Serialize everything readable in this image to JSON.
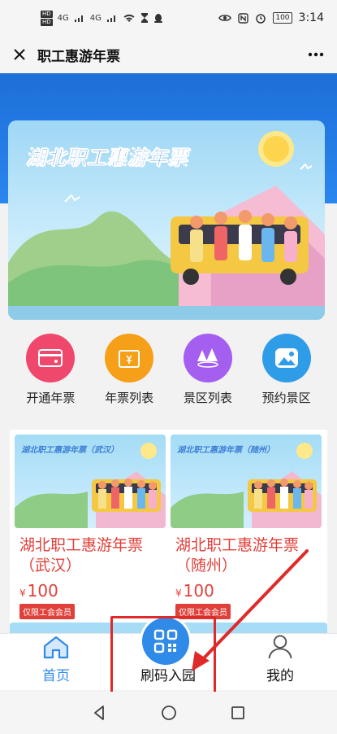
{
  "status_bar": {
    "sim1": "HD",
    "sim2": "HD",
    "network1": "4G",
    "network2": "4G",
    "battery": "100",
    "time": "3:14"
  },
  "title_bar": {
    "title": "职工惠游年票"
  },
  "banner": {
    "title": "湖北职工惠游年票"
  },
  "menu": [
    {
      "label": "开通年票",
      "icon": "card-icon",
      "color": "#f0476c"
    },
    {
      "label": "年票列表",
      "icon": "wallet-icon",
      "color": "#f5a018"
    },
    {
      "label": "景区列表",
      "icon": "trees-icon",
      "color": "#a45ef0"
    },
    {
      "label": "预约景区",
      "icon": "mountain-photo-icon",
      "color": "#2f9ce8"
    }
  ],
  "products": [
    {
      "image_title": "湖北职工惠游年票（武汉）",
      "name": "湖北职工惠游年票（武汉）",
      "currency": "¥",
      "price": "100",
      "badge": "仅限工会会员"
    },
    {
      "image_title": "湖北职工惠游年票（随州）",
      "name": "湖北职工惠游年票（随州）",
      "currency": "¥",
      "price": "100",
      "badge": "仅限工会会员"
    }
  ],
  "bottom_nav": {
    "home": "首页",
    "scan": "刷码入园",
    "mine": "我的"
  },
  "colors": {
    "accent": "#2f8ae8",
    "price_red": "#e0403a",
    "annotation_red": "#e02a2a"
  }
}
